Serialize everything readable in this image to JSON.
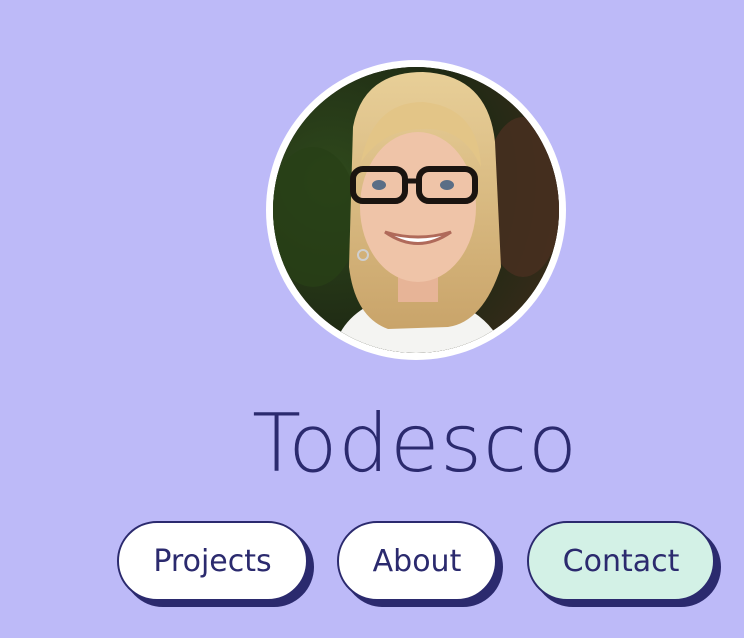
{
  "profile": {
    "name": "Todesco",
    "avatar_icon": "portrait-photo"
  },
  "nav": {
    "items": [
      {
        "label": "Projects",
        "bg": "#ffffff"
      },
      {
        "label": "About",
        "bg": "#ffffff"
      },
      {
        "label": "Contact",
        "bg": "#d3f1e6"
      }
    ]
  },
  "colors": {
    "background": "#bdbaf8",
    "accent": "#2b2a6e"
  }
}
